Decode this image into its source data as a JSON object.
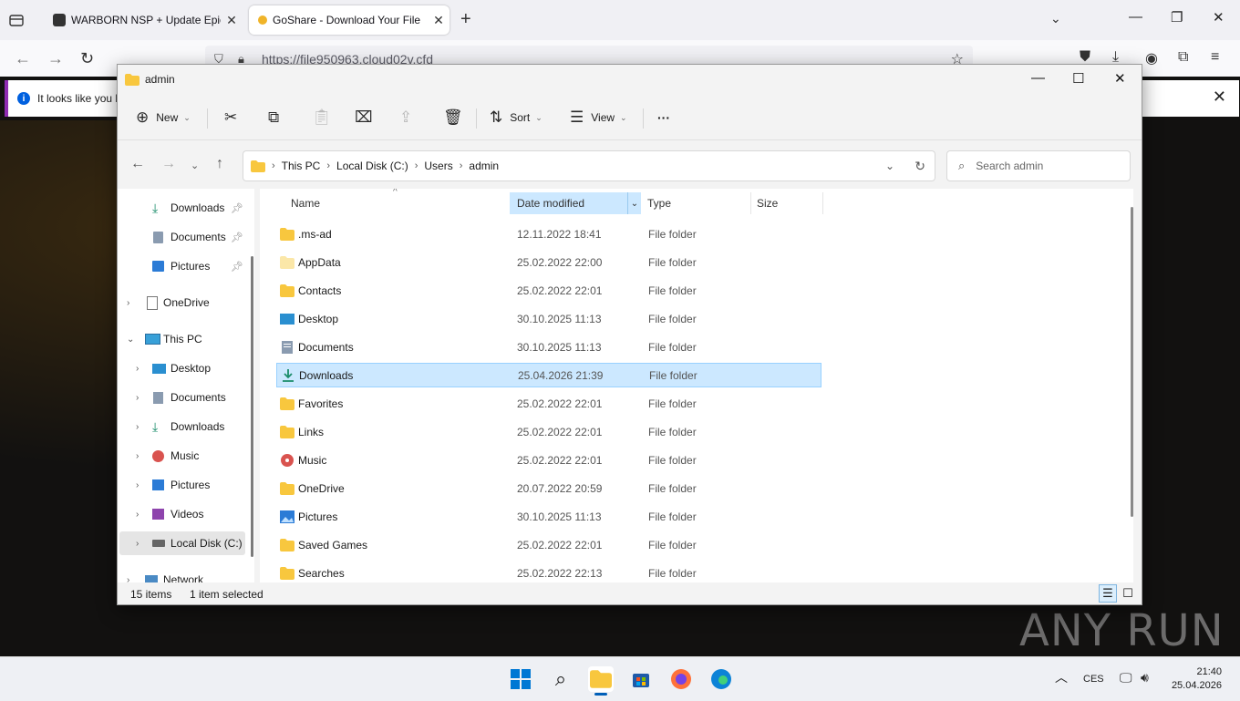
{
  "browser": {
    "tabs": [
      {
        "title": "WARBORN NSP + Update Epic N",
        "active": false
      },
      {
        "title": "GoShare - Download Your File",
        "active": true
      }
    ],
    "url": "https://file950963.cloud02v.cfd",
    "notification": "It looks like you h"
  },
  "explorer": {
    "window_title": "admin",
    "toolbar": {
      "new_label": "New",
      "sort_label": "Sort",
      "view_label": "View",
      "more_label": "···"
    },
    "breadcrumb": [
      "This PC",
      "Local Disk (C:)",
      "Users",
      "admin"
    ],
    "search_placeholder": "Search admin",
    "columns": {
      "name": "Name",
      "date": "Date modified",
      "type": "Type",
      "size": "Size"
    },
    "sidebar": [
      {
        "label": "Downloads",
        "icon": "download-icon",
        "pinned": true
      },
      {
        "label": "Documents",
        "icon": "documents-icon",
        "pinned": true
      },
      {
        "label": "Pictures",
        "icon": "pictures-icon",
        "pinned": true
      },
      {
        "label": "OneDrive",
        "icon": "onedrive-icon"
      },
      {
        "label": "This PC",
        "icon": "this-pc-icon"
      },
      {
        "label": "Desktop",
        "icon": "desktop-icon"
      },
      {
        "label": "Documents",
        "icon": "documents-icon"
      },
      {
        "label": "Downloads",
        "icon": "download-icon"
      },
      {
        "label": "Music",
        "icon": "music-icon"
      },
      {
        "label": "Pictures",
        "icon": "pictures-icon"
      },
      {
        "label": "Videos",
        "icon": "videos-icon"
      },
      {
        "label": "Local Disk (C:)",
        "icon": "drive-icon",
        "selected": true
      },
      {
        "label": "Network",
        "icon": "network-icon"
      }
    ],
    "files": [
      {
        "name": ".ms-ad",
        "date": "12.11.2022 18:41",
        "type": "File folder",
        "icon": "folder-icon"
      },
      {
        "name": "AppData",
        "date": "25.02.2022 22:00",
        "type": "File folder",
        "icon": "folder-hidden-icon"
      },
      {
        "name": "Contacts",
        "date": "25.02.2022 22:01",
        "type": "File folder",
        "icon": "folder-icon"
      },
      {
        "name": "Desktop",
        "date": "30.10.2025 11:13",
        "type": "File folder",
        "icon": "desktop-icon"
      },
      {
        "name": "Documents",
        "date": "30.10.2025 11:13",
        "type": "File folder",
        "icon": "documents-icon"
      },
      {
        "name": "Downloads",
        "date": "25.04.2026 21:39",
        "type": "File folder",
        "icon": "download-icon",
        "selected": true
      },
      {
        "name": "Favorites",
        "date": "25.02.2022 22:01",
        "type": "File folder",
        "icon": "folder-icon"
      },
      {
        "name": "Links",
        "date": "25.02.2022 22:01",
        "type": "File folder",
        "icon": "folder-icon"
      },
      {
        "name": "Music",
        "date": "25.02.2022 22:01",
        "type": "File folder",
        "icon": "music-icon"
      },
      {
        "name": "OneDrive",
        "date": "20.07.2022 20:59",
        "type": "File folder",
        "icon": "folder-icon"
      },
      {
        "name": "Pictures",
        "date": "30.10.2025 11:13",
        "type": "File folder",
        "icon": "pictures-icon"
      },
      {
        "name": "Saved Games",
        "date": "25.02.2022 22:01",
        "type": "File folder",
        "icon": "folder-icon"
      },
      {
        "name": "Searches",
        "date": "25.02.2022 22:13",
        "type": "File folder",
        "icon": "folder-icon"
      }
    ],
    "status": {
      "count": "15 items",
      "selection": "1 item selected"
    }
  },
  "watermark": "ANY RUN",
  "taskbar": {
    "language": "CES",
    "time": "21:40",
    "date": "25.04.2026"
  },
  "colors": {
    "accent": "#005fb8",
    "selection": "#cce8ff",
    "folder": "#f8c73e"
  }
}
